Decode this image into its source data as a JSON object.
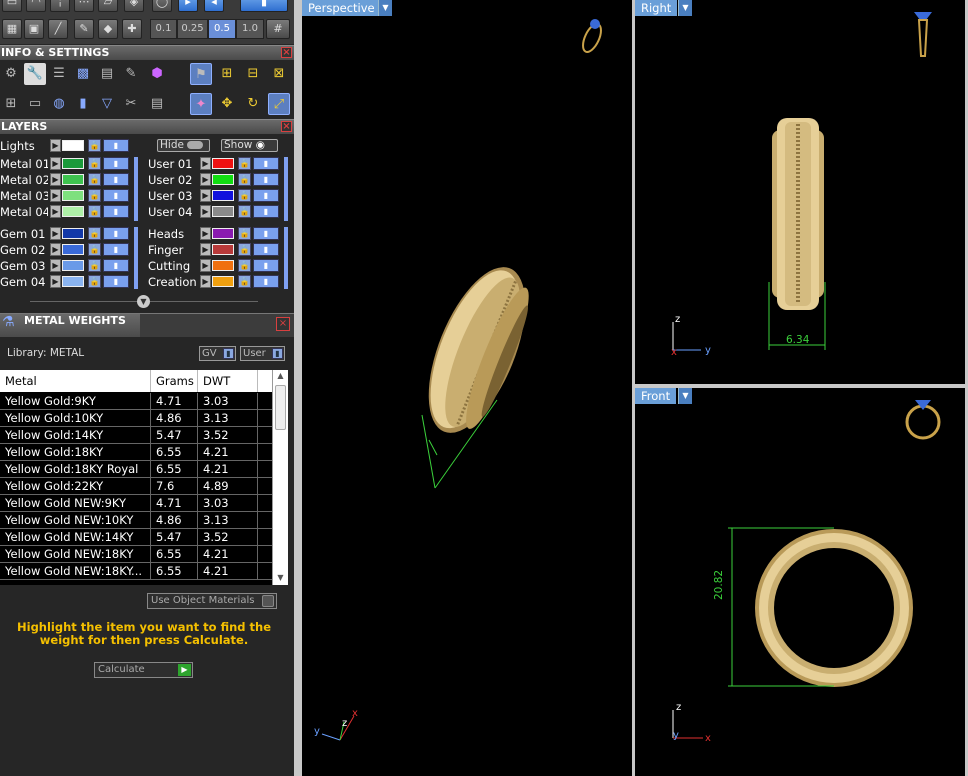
{
  "toolbar": {
    "scale_options": [
      "0.1",
      "0.25",
      "0.5",
      "1.0"
    ],
    "selected_scale": "0.5"
  },
  "info_settings": {
    "title": "INFO & SETTINGS"
  },
  "layers": {
    "title": "LAYERS",
    "lights_label": "Lights",
    "hide_label": "Hide",
    "show_label": "Show",
    "left_column": [
      {
        "name": "Metal 01",
        "color": "#1a9a3a"
      },
      {
        "name": "Metal 02",
        "color": "#3ec24f"
      },
      {
        "name": "Metal 03",
        "color": "#7ee07e"
      },
      {
        "name": "Metal 04",
        "color": "#aef0a8"
      },
      {
        "name": "Gem 01",
        "color": "#1238a8"
      },
      {
        "name": "Gem 02",
        "color": "#3a6ad8"
      },
      {
        "name": "Gem 03",
        "color": "#6a9ae8"
      },
      {
        "name": "Gem 04",
        "color": "#8ab4f0"
      }
    ],
    "right_column": [
      {
        "name": "User 01",
        "color": "#ee1111"
      },
      {
        "name": "User 02",
        "color": "#11dd11"
      },
      {
        "name": "User 03",
        "color": "#1111dd"
      },
      {
        "name": "User 04",
        "color": "#8a8a8a"
      },
      {
        "name": "Heads",
        "color": "#8a1ab0"
      },
      {
        "name": "Finger",
        "color": "#b83a3a"
      },
      {
        "name": "Cutting",
        "color": "#f07010"
      },
      {
        "name": "Creation",
        "color": "#f0a010"
      }
    ]
  },
  "metal_weights": {
    "title": "METAL WEIGHTS",
    "library_label": "Library: METAL",
    "gv_label": "GV",
    "user_label": "User",
    "columns": [
      "Metal",
      "Grams",
      "DWT"
    ],
    "rows": [
      [
        "Yellow Gold:9KY",
        "4.71",
        "3.03"
      ],
      [
        "Yellow Gold:10KY",
        "4.86",
        "3.13"
      ],
      [
        "Yellow Gold:14KY",
        "5.47",
        "3.52"
      ],
      [
        "Yellow Gold:18KY",
        "6.55",
        "4.21"
      ],
      [
        "Yellow Gold:18KY Royal",
        "6.55",
        "4.21"
      ],
      [
        "Yellow Gold:22KY",
        "7.6",
        "4.89"
      ],
      [
        "Yellow Gold NEW:9KY",
        "4.71",
        "3.03"
      ],
      [
        "Yellow Gold NEW:10KY",
        "4.86",
        "3.13"
      ],
      [
        "Yellow Gold NEW:14KY",
        "5.47",
        "3.52"
      ],
      [
        "Yellow Gold NEW:18KY",
        "6.55",
        "4.21"
      ],
      [
        "Yellow Gold NEW:18KY...",
        "6.55",
        "4.21"
      ]
    ],
    "use_object_materials": "Use Object Materials",
    "hint": "Highlight the item you want to find the weight for then press Calculate.",
    "calculate_label": "Calculate"
  },
  "viewports": {
    "perspective": {
      "label": "Perspective"
    },
    "right": {
      "label": "Right",
      "dimension": "6.34",
      "axis_z": "z",
      "axis_y": "y",
      "axis_x": "x"
    },
    "front": {
      "label": "Front",
      "dimension": "20.82",
      "axis_z": "z",
      "axis_y": "y",
      "axis_x": "x"
    }
  },
  "colors": {
    "panel_bg": "#262626",
    "accent_blue": "#6a9fd8",
    "dimension_green": "#3bd13b",
    "gold": "#d8bf85",
    "hint_yellow": "#f5c000"
  }
}
